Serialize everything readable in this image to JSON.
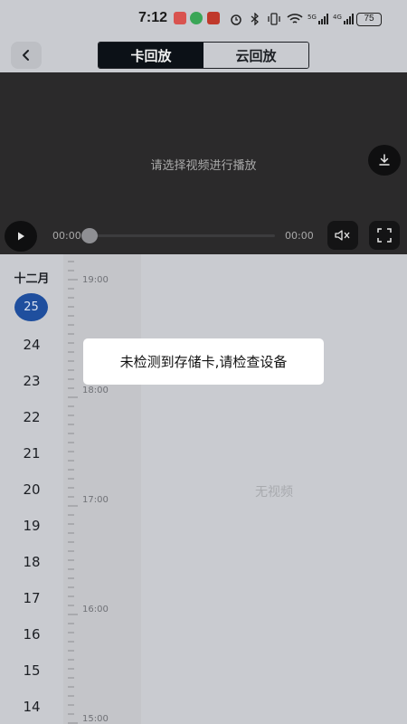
{
  "status_bar": {
    "time": "7:12",
    "icons": [
      "weibo-icon",
      "wechat-icon",
      "news-app-icon",
      "alarm-icon",
      "bluetooth-icon",
      "vibrate-icon",
      "wifi-icon",
      "signal-5g-icon",
      "signal-4g-icon"
    ],
    "battery": "75"
  },
  "header": {
    "tabs": [
      {
        "label": "卡回放",
        "active": true
      },
      {
        "label": "云回放",
        "active": false
      }
    ]
  },
  "player": {
    "message": "请选择视频进行播放",
    "current_time": "00:00",
    "total_time": "00:00",
    "progress": 0
  },
  "calendar": {
    "month": "十二月",
    "selected_day": "25",
    "days": [
      "24",
      "23",
      "22",
      "21",
      "20",
      "19",
      "18",
      "17",
      "16",
      "15",
      "14"
    ]
  },
  "timeline": {
    "hours": [
      "19:00",
      "18:00",
      "17:00",
      "16:00",
      "15:00"
    ]
  },
  "content": {
    "empty_text": "无视频"
  },
  "toast": {
    "message": "未检测到存储卡,请检查设备"
  },
  "colors": {
    "accent": "#1f4f9e",
    "player_bg": "#2b2a2b",
    "overlay": "#c9cbd0"
  }
}
